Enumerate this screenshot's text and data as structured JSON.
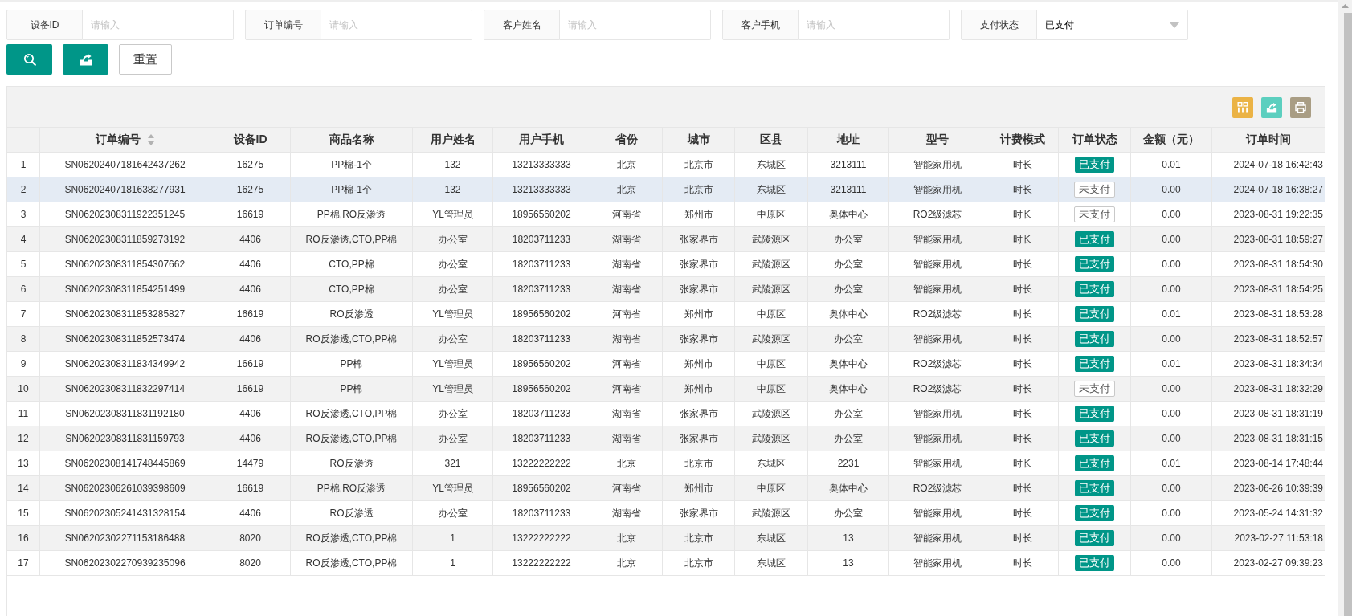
{
  "filters": [
    {
      "kind": "input",
      "label": "设备ID",
      "placeholder": "请输入"
    },
    {
      "kind": "input",
      "label": "订单编号",
      "placeholder": "请输入"
    },
    {
      "kind": "input",
      "label": "客户姓名",
      "placeholder": "请输入"
    },
    {
      "kind": "input",
      "label": "客户手机",
      "placeholder": "请输入"
    },
    {
      "kind": "select",
      "label": "支付状态",
      "value": "已支付"
    }
  ],
  "buttons": [
    {
      "kind": "search"
    },
    {
      "kind": "export"
    },
    {
      "kind": "reset",
      "label": "重置"
    }
  ],
  "table": {
    "tools": [
      {
        "kind": "columns"
      },
      {
        "kind": "export"
      },
      {
        "kind": "print"
      }
    ],
    "columns": [
      {
        "label": "订单编号",
        "kind": "text",
        "sortable": true
      },
      {
        "label": "设备ID",
        "kind": "text",
        "sortable": false
      },
      {
        "label": "商品名称",
        "kind": "text",
        "sortable": false
      },
      {
        "label": "用户姓名",
        "kind": "text",
        "sortable": false
      },
      {
        "label": "用户手机",
        "kind": "text",
        "sortable": false
      },
      {
        "label": "省份",
        "kind": "text",
        "sortable": false
      },
      {
        "label": "城市",
        "kind": "text",
        "sortable": false
      },
      {
        "label": "区县",
        "kind": "text",
        "sortable": false
      },
      {
        "label": "地址",
        "kind": "text",
        "sortable": false
      },
      {
        "label": "型号",
        "kind": "text",
        "sortable": false
      },
      {
        "label": "计费模式",
        "kind": "text",
        "sortable": false
      },
      {
        "label": "订单状态",
        "kind": "status",
        "sortable": false
      },
      {
        "label": "金额（元）",
        "kind": "text",
        "sortable": false
      },
      {
        "label": "订单时间",
        "kind": "text",
        "sortable": false
      }
    ],
    "rows": [
      {
        "no": "1",
        "paid": true,
        "hovered": false,
        "cells": [
          "SN06202407181642437262",
          "16275",
          "PP棉-1个",
          "132",
          "13213333333",
          "北京",
          "北京市",
          "东城区",
          "3213111",
          "智能家用机",
          "时长",
          "已支付",
          "0.01",
          "2024-07-18 16:42:43"
        ]
      },
      {
        "no": "2",
        "paid": false,
        "hovered": true,
        "cells": [
          "SN06202407181638277931",
          "16275",
          "PP棉-1个",
          "132",
          "13213333333",
          "北京",
          "北京市",
          "东城区",
          "3213111",
          "智能家用机",
          "时长",
          "未支付",
          "0.00",
          "2024-07-18 16:38:27"
        ]
      },
      {
        "no": "3",
        "paid": false,
        "hovered": false,
        "cells": [
          "SN06202308311922351245",
          "16619",
          "PP棉,RO反渗透",
          "YL管理员",
          "18956560202",
          "河南省",
          "郑州市",
          "中原区",
          "奥体中心",
          "RO2级滤芯",
          "时长",
          "未支付",
          "0.00",
          "2023-08-31 19:22:35"
        ]
      },
      {
        "no": "4",
        "paid": true,
        "hovered": false,
        "cells": [
          "SN06202308311859273192",
          "4406",
          "RO反渗透,CTO,PP棉",
          "办公室",
          "18203711233",
          "湖南省",
          "张家界市",
          "武陵源区",
          "办公室",
          "智能家用机",
          "时长",
          "已支付",
          "0.00",
          "2023-08-31 18:59:27"
        ]
      },
      {
        "no": "5",
        "paid": true,
        "hovered": false,
        "cells": [
          "SN06202308311854307662",
          "4406",
          "CTO,PP棉",
          "办公室",
          "18203711233",
          "湖南省",
          "张家界市",
          "武陵源区",
          "办公室",
          "智能家用机",
          "时长",
          "已支付",
          "0.00",
          "2023-08-31 18:54:30"
        ]
      },
      {
        "no": "6",
        "paid": true,
        "hovered": false,
        "cells": [
          "SN06202308311854251499",
          "4406",
          "CTO,PP棉",
          "办公室",
          "18203711233",
          "湖南省",
          "张家界市",
          "武陵源区",
          "办公室",
          "智能家用机",
          "时长",
          "已支付",
          "0.00",
          "2023-08-31 18:54:25"
        ]
      },
      {
        "no": "7",
        "paid": true,
        "hovered": false,
        "cells": [
          "SN06202308311853285827",
          "16619",
          "RO反渗透",
          "YL管理员",
          "18956560202",
          "河南省",
          "郑州市",
          "中原区",
          "奥体中心",
          "RO2级滤芯",
          "时长",
          "已支付",
          "0.01",
          "2023-08-31 18:53:28"
        ]
      },
      {
        "no": "8",
        "paid": true,
        "hovered": false,
        "cells": [
          "SN06202308311852573474",
          "4406",
          "RO反渗透,CTO,PP棉",
          "办公室",
          "18203711233",
          "湖南省",
          "张家界市",
          "武陵源区",
          "办公室",
          "智能家用机",
          "时长",
          "已支付",
          "0.00",
          "2023-08-31 18:52:57"
        ]
      },
      {
        "no": "9",
        "paid": true,
        "hovered": false,
        "cells": [
          "SN06202308311834349942",
          "16619",
          "PP棉",
          "YL管理员",
          "18956560202",
          "河南省",
          "郑州市",
          "中原区",
          "奥体中心",
          "RO2级滤芯",
          "时长",
          "已支付",
          "0.01",
          "2023-08-31 18:34:34"
        ]
      },
      {
        "no": "10",
        "paid": false,
        "hovered": false,
        "cells": [
          "SN06202308311832297414",
          "16619",
          "PP棉",
          "YL管理员",
          "18956560202",
          "河南省",
          "郑州市",
          "中原区",
          "奥体中心",
          "RO2级滤芯",
          "时长",
          "未支付",
          "0.00",
          "2023-08-31 18:32:29"
        ]
      },
      {
        "no": "11",
        "paid": true,
        "hovered": false,
        "cells": [
          "SN06202308311831192180",
          "4406",
          "RO反渗透,CTO,PP棉",
          "办公室",
          "18203711233",
          "湖南省",
          "张家界市",
          "武陵源区",
          "办公室",
          "智能家用机",
          "时长",
          "已支付",
          "0.00",
          "2023-08-31 18:31:19"
        ]
      },
      {
        "no": "12",
        "paid": true,
        "hovered": false,
        "cells": [
          "SN06202308311831159793",
          "4406",
          "RO反渗透,CTO,PP棉",
          "办公室",
          "18203711233",
          "湖南省",
          "张家界市",
          "武陵源区",
          "办公室",
          "智能家用机",
          "时长",
          "已支付",
          "0.00",
          "2023-08-31 18:31:15"
        ]
      },
      {
        "no": "13",
        "paid": true,
        "hovered": false,
        "cells": [
          "SN06202308141748445869",
          "14479",
          "RO反渗透",
          "321",
          "13222222222",
          "北京",
          "北京市",
          "东城区",
          "2231",
          "智能家用机",
          "时长",
          "已支付",
          "0.01",
          "2023-08-14 17:48:44"
        ]
      },
      {
        "no": "14",
        "paid": true,
        "hovered": false,
        "cells": [
          "SN06202306261039398609",
          "16619",
          "PP棉,RO反渗透",
          "YL管理员",
          "18956560202",
          "河南省",
          "郑州市",
          "中原区",
          "奥体中心",
          "RO2级滤芯",
          "时长",
          "已支付",
          "0.00",
          "2023-06-26 10:39:39"
        ]
      },
      {
        "no": "15",
        "paid": true,
        "hovered": false,
        "cells": [
          "SN06202305241431328154",
          "4406",
          "RO反渗透",
          "办公室",
          "18203711233",
          "湖南省",
          "张家界市",
          "武陵源区",
          "办公室",
          "智能家用机",
          "时长",
          "已支付",
          "0.00",
          "2023-05-24 14:31:32"
        ]
      },
      {
        "no": "16",
        "paid": true,
        "hovered": false,
        "cells": [
          "SN06202302271153186488",
          "8020",
          "RO反渗透,CTO,PP棉",
          "1",
          "13222222222",
          "北京",
          "北京市",
          "东城区",
          "13",
          "智能家用机",
          "时长",
          "已支付",
          "0.00",
          "2023-02-27 11:53:18"
        ]
      },
      {
        "no": "17",
        "paid": true,
        "hovered": false,
        "cells": [
          "SN06202302270939235096",
          "8020",
          "RO反渗透,CTO,PP棉",
          "1",
          "13222222222",
          "北京",
          "北京市",
          "东城区",
          "13",
          "智能家用机",
          "时长",
          "已支付",
          "0.00",
          "2023-02-27 09:39:23"
        ]
      }
    ]
  }
}
